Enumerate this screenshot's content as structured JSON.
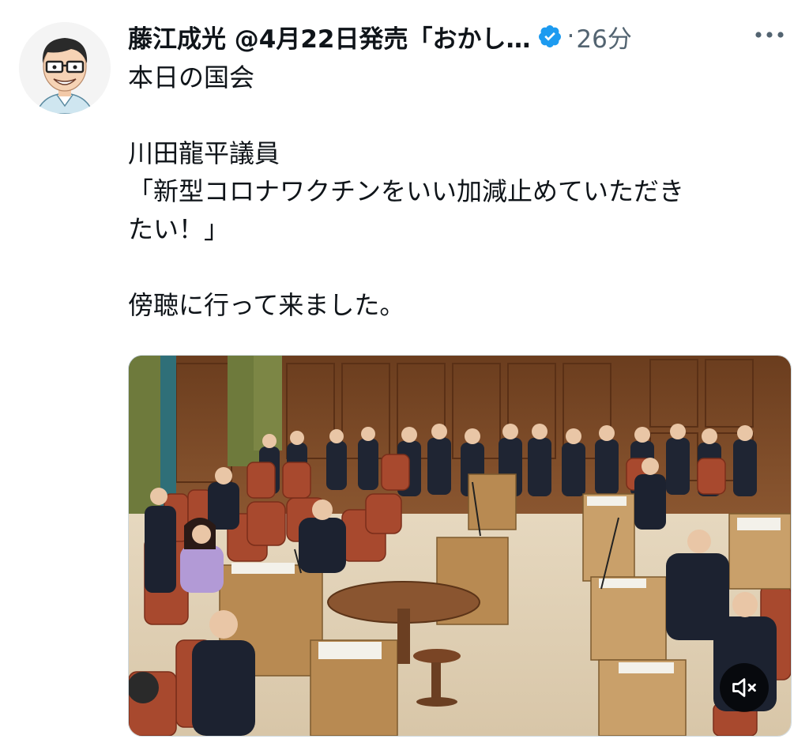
{
  "tweet": {
    "author": {
      "display_name": "藤江成光 @4月22日発売「おかし…",
      "avatar_icon": "cartoon-avatar-icon",
      "verified_icon": "verified-badge-icon",
      "verified_color": "#1d9bf0"
    },
    "separator": "·",
    "timestamp": "26分",
    "more_icon": "more-options-icon",
    "text_lines": [
      "本日の国会",
      "",
      "川田龍平議員",
      "「新型コロナワクチンをいい加減止めていただき",
      "たい！」",
      "",
      "傍聴に行って来ました。"
    ],
    "media": {
      "type": "video",
      "mute_icon": "muted-speaker-icon"
    }
  }
}
